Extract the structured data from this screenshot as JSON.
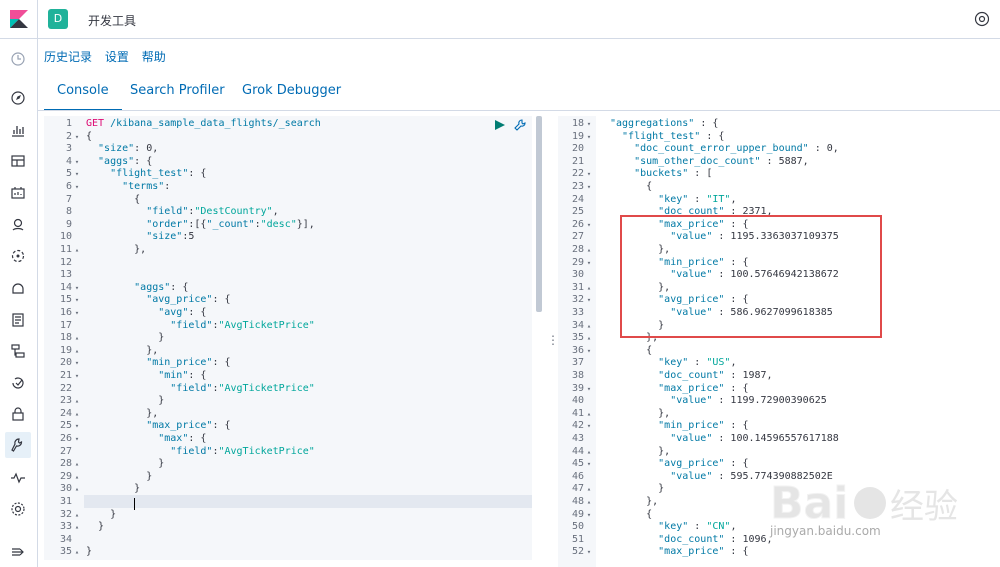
{
  "header": {
    "space_badge": "D",
    "title": "开发工具"
  },
  "links": [
    "历史记录",
    "设置",
    "帮助"
  ],
  "tabs": [
    "Console",
    "Search Profiler",
    "Grok Debugger"
  ],
  "editor_lines": [
    {
      "n": "1",
      "f": "",
      "t": [
        [
          "m",
          "GET"
        ],
        [
          "k",
          " /kibana_sample_data_flights/_search"
        ]
      ]
    },
    {
      "n": "2",
      "f": "▾",
      "t": [
        [
          "p",
          "{"
        ]
      ]
    },
    {
      "n": "3",
      "f": "",
      "t": [
        [
          "k",
          "  \"size\""
        ],
        [
          "p",
          ": "
        ],
        [
          "n",
          "0"
        ],
        [
          "p",
          ","
        ]
      ]
    },
    {
      "n": "4",
      "f": "▾",
      "t": [
        [
          "k",
          "  \"aggs\""
        ],
        [
          "p",
          ": {"
        ]
      ]
    },
    {
      "n": "5",
      "f": "▾",
      "t": [
        [
          "k",
          "    \"flight_test\""
        ],
        [
          "p",
          ": {"
        ]
      ]
    },
    {
      "n": "6",
      "f": "▾",
      "t": [
        [
          "k",
          "      \"terms\""
        ],
        [
          "p",
          ":"
        ]
      ]
    },
    {
      "n": "7",
      "f": "",
      "t": [
        [
          "p",
          "        {"
        ]
      ]
    },
    {
      "n": "8",
      "f": "",
      "t": [
        [
          "k",
          "          \"field\""
        ],
        [
          "p",
          ":"
        ],
        [
          "s",
          "\"DestCountry\""
        ],
        [
          "p",
          ","
        ]
      ]
    },
    {
      "n": "9",
      "f": "",
      "t": [
        [
          "k",
          "          \"order\""
        ],
        [
          "p",
          ":[{"
        ],
        [
          "k",
          "\"_count\""
        ],
        [
          "p",
          ":"
        ],
        [
          "s",
          "\"desc\""
        ],
        [
          "p",
          "}],"
        ]
      ]
    },
    {
      "n": "10",
      "f": "",
      "t": [
        [
          "k",
          "          \"size\""
        ],
        [
          "p",
          ":"
        ],
        [
          "n",
          "5"
        ]
      ]
    },
    {
      "n": "11",
      "f": "▴",
      "t": [
        [
          "p",
          "        },"
        ]
      ]
    },
    {
      "n": "12",
      "f": "",
      "t": []
    },
    {
      "n": "13",
      "f": "",
      "t": []
    },
    {
      "n": "14",
      "f": "▾",
      "t": [
        [
          "k",
          "        \"aggs\""
        ],
        [
          "p",
          ": {"
        ]
      ]
    },
    {
      "n": "15",
      "f": "▾",
      "t": [
        [
          "k",
          "          \"avg_price\""
        ],
        [
          "p",
          ": {"
        ]
      ]
    },
    {
      "n": "16",
      "f": "▾",
      "t": [
        [
          "k",
          "            \"avg\""
        ],
        [
          "p",
          ": {"
        ]
      ]
    },
    {
      "n": "17",
      "f": "",
      "t": [
        [
          "k",
          "              \"field\""
        ],
        [
          "p",
          ":"
        ],
        [
          "s",
          "\"AvgTicketPrice\""
        ]
      ]
    },
    {
      "n": "18",
      "f": "▴",
      "t": [
        [
          "p",
          "            }"
        ]
      ]
    },
    {
      "n": "19",
      "f": "▴",
      "t": [
        [
          "p",
          "          },"
        ]
      ]
    },
    {
      "n": "20",
      "f": "▾",
      "t": [
        [
          "k",
          "          \"min_price\""
        ],
        [
          "p",
          ": {"
        ]
      ]
    },
    {
      "n": "21",
      "f": "▾",
      "t": [
        [
          "k",
          "            \"min\""
        ],
        [
          "p",
          ": {"
        ]
      ]
    },
    {
      "n": "22",
      "f": "",
      "t": [
        [
          "k",
          "              \"field\""
        ],
        [
          "p",
          ":"
        ],
        [
          "s",
          "\"AvgTicketPrice\""
        ]
      ]
    },
    {
      "n": "23",
      "f": "▴",
      "t": [
        [
          "p",
          "            }"
        ]
      ]
    },
    {
      "n": "24",
      "f": "▴",
      "t": [
        [
          "p",
          "          },"
        ]
      ]
    },
    {
      "n": "25",
      "f": "▾",
      "t": [
        [
          "k",
          "          \"max_price\""
        ],
        [
          "p",
          ": {"
        ]
      ]
    },
    {
      "n": "26",
      "f": "▾",
      "t": [
        [
          "k",
          "            \"max\""
        ],
        [
          "p",
          ": {"
        ]
      ]
    },
    {
      "n": "27",
      "f": "",
      "t": [
        [
          "k",
          "              \"field\""
        ],
        [
          "p",
          ":"
        ],
        [
          "s",
          "\"AvgTicketPrice\""
        ]
      ]
    },
    {
      "n": "28",
      "f": "▴",
      "t": [
        [
          "p",
          "            }"
        ]
      ]
    },
    {
      "n": "29",
      "f": "▴",
      "t": [
        [
          "p",
          "          }"
        ]
      ]
    },
    {
      "n": "30",
      "f": "▴",
      "t": [
        [
          "p",
          "        }"
        ]
      ]
    },
    {
      "n": "31",
      "f": "",
      "t": []
    },
    {
      "n": "32",
      "f": "▴",
      "t": [
        [
          "p",
          "    }"
        ]
      ]
    },
    {
      "n": "33",
      "f": "▴",
      "t": [
        [
          "p",
          "  }"
        ]
      ]
    },
    {
      "n": "34",
      "f": "",
      "t": []
    },
    {
      "n": "35",
      "f": "▴",
      "t": [
        [
          "p",
          "}"
        ]
      ]
    }
  ],
  "output_lines": [
    {
      "n": "18",
      "f": "▾",
      "t": [
        [
          "k",
          "\"aggregations\""
        ],
        [
          "p",
          " : {"
        ]
      ]
    },
    {
      "n": "19",
      "f": "▾",
      "t": [
        [
          "k",
          "  \"flight_test\""
        ],
        [
          "p",
          " : {"
        ]
      ]
    },
    {
      "n": "20",
      "f": "",
      "t": [
        [
          "k",
          "    \"doc_count_error_upper_bound\""
        ],
        [
          "p",
          " : "
        ],
        [
          "n",
          "0"
        ],
        [
          "p",
          ","
        ]
      ]
    },
    {
      "n": "21",
      "f": "",
      "t": [
        [
          "k",
          "    \"sum_other_doc_count\""
        ],
        [
          "p",
          " : "
        ],
        [
          "n",
          "5887"
        ],
        [
          "p",
          ","
        ]
      ]
    },
    {
      "n": "22",
      "f": "▾",
      "t": [
        [
          "k",
          "    \"buckets\""
        ],
        [
          "p",
          " : ["
        ]
      ]
    },
    {
      "n": "23",
      "f": "▾",
      "t": [
        [
          "p",
          "      {"
        ]
      ]
    },
    {
      "n": "24",
      "f": "",
      "t": [
        [
          "k",
          "        \"key\""
        ],
        [
          "p",
          " : "
        ],
        [
          "s",
          "\"IT\""
        ],
        [
          "p",
          ","
        ]
      ]
    },
    {
      "n": "25",
      "f": "",
      "t": [
        [
          "k",
          "        \"doc_count\""
        ],
        [
          "p",
          " : "
        ],
        [
          "n",
          "2371"
        ],
        [
          "p",
          ","
        ]
      ]
    },
    {
      "n": "26",
      "f": "▾",
      "t": [
        [
          "k",
          "        \"max_price\""
        ],
        [
          "p",
          " : {"
        ]
      ]
    },
    {
      "n": "27",
      "f": "",
      "t": [
        [
          "k",
          "          \"value\""
        ],
        [
          "p",
          " : "
        ],
        [
          "n",
          "1195.3363037109375"
        ]
      ]
    },
    {
      "n": "28",
      "f": "▴",
      "t": [
        [
          "p",
          "        },"
        ]
      ]
    },
    {
      "n": "29",
      "f": "▾",
      "t": [
        [
          "k",
          "        \"min_price\""
        ],
        [
          "p",
          " : {"
        ]
      ]
    },
    {
      "n": "30",
      "f": "",
      "t": [
        [
          "k",
          "          \"value\""
        ],
        [
          "p",
          " : "
        ],
        [
          "n",
          "100.57646942138672"
        ]
      ]
    },
    {
      "n": "31",
      "f": "▴",
      "t": [
        [
          "p",
          "        },"
        ]
      ]
    },
    {
      "n": "32",
      "f": "▾",
      "t": [
        [
          "k",
          "        \"avg_price\""
        ],
        [
          "p",
          " : {"
        ]
      ]
    },
    {
      "n": "33",
      "f": "",
      "t": [
        [
          "k",
          "          \"value\""
        ],
        [
          "p",
          " : "
        ],
        [
          "n",
          "586.9627099618385"
        ]
      ]
    },
    {
      "n": "34",
      "f": "▴",
      "t": [
        [
          "p",
          "        }"
        ]
      ]
    },
    {
      "n": "35",
      "f": "▴",
      "t": [
        [
          "p",
          "      },"
        ]
      ]
    },
    {
      "n": "36",
      "f": "▾",
      "t": [
        [
          "p",
          "      {"
        ]
      ]
    },
    {
      "n": "37",
      "f": "",
      "t": [
        [
          "k",
          "        \"key\""
        ],
        [
          "p",
          " : "
        ],
        [
          "s",
          "\"US\""
        ],
        [
          "p",
          ","
        ]
      ]
    },
    {
      "n": "38",
      "f": "",
      "t": [
        [
          "k",
          "        \"doc_count\""
        ],
        [
          "p",
          " : "
        ],
        [
          "n",
          "1987"
        ],
        [
          "p",
          ","
        ]
      ]
    },
    {
      "n": "39",
      "f": "▾",
      "t": [
        [
          "k",
          "        \"max_price\""
        ],
        [
          "p",
          " : {"
        ]
      ]
    },
    {
      "n": "40",
      "f": "",
      "t": [
        [
          "k",
          "          \"value\""
        ],
        [
          "p",
          " : "
        ],
        [
          "n",
          "1199.72900390625"
        ]
      ]
    },
    {
      "n": "41",
      "f": "▴",
      "t": [
        [
          "p",
          "        },"
        ]
      ]
    },
    {
      "n": "42",
      "f": "▾",
      "t": [
        [
          "k",
          "        \"min_price\""
        ],
        [
          "p",
          " : {"
        ]
      ]
    },
    {
      "n": "43",
      "f": "",
      "t": [
        [
          "k",
          "          \"value\""
        ],
        [
          "p",
          " : "
        ],
        [
          "n",
          "100.14596557617188"
        ]
      ]
    },
    {
      "n": "44",
      "f": "▴",
      "t": [
        [
          "p",
          "        },"
        ]
      ]
    },
    {
      "n": "45",
      "f": "▾",
      "t": [
        [
          "k",
          "        \"avg_price\""
        ],
        [
          "p",
          " : {"
        ]
      ]
    },
    {
      "n": "46",
      "f": "",
      "t": [
        [
          "k",
          "          \"value\""
        ],
        [
          "p",
          " : "
        ],
        [
          "n",
          "595.774390882502E"
        ]
      ]
    },
    {
      "n": "47",
      "f": "▴",
      "t": [
        [
          "p",
          "        }"
        ]
      ]
    },
    {
      "n": "48",
      "f": "▴",
      "t": [
        [
          "p",
          "      },"
        ]
      ]
    },
    {
      "n": "49",
      "f": "▾",
      "t": [
        [
          "p",
          "      {"
        ]
      ]
    },
    {
      "n": "50",
      "f": "",
      "t": [
        [
          "k",
          "        \"key\""
        ],
        [
          "p",
          " : "
        ],
        [
          "s",
          "\"CN\""
        ],
        [
          "p",
          ","
        ]
      ]
    },
    {
      "n": "51",
      "f": "",
      "t": [
        [
          "k",
          "        \"doc_count\""
        ],
        [
          "p",
          " : "
        ],
        [
          "n",
          "1096"
        ],
        [
          "p",
          ","
        ]
      ]
    },
    {
      "n": "52",
      "f": "▾",
      "t": [
        [
          "k",
          "        \"max_price\""
        ],
        [
          "p",
          " : {"
        ]
      ]
    }
  ],
  "watermark": "jingyan.baidu.com",
  "colors": {
    "accent": "#006bb4",
    "highlight_box": "#e04a4a",
    "method": "#dd0a73",
    "key": "#0079a5",
    "string": "#00a69b"
  }
}
